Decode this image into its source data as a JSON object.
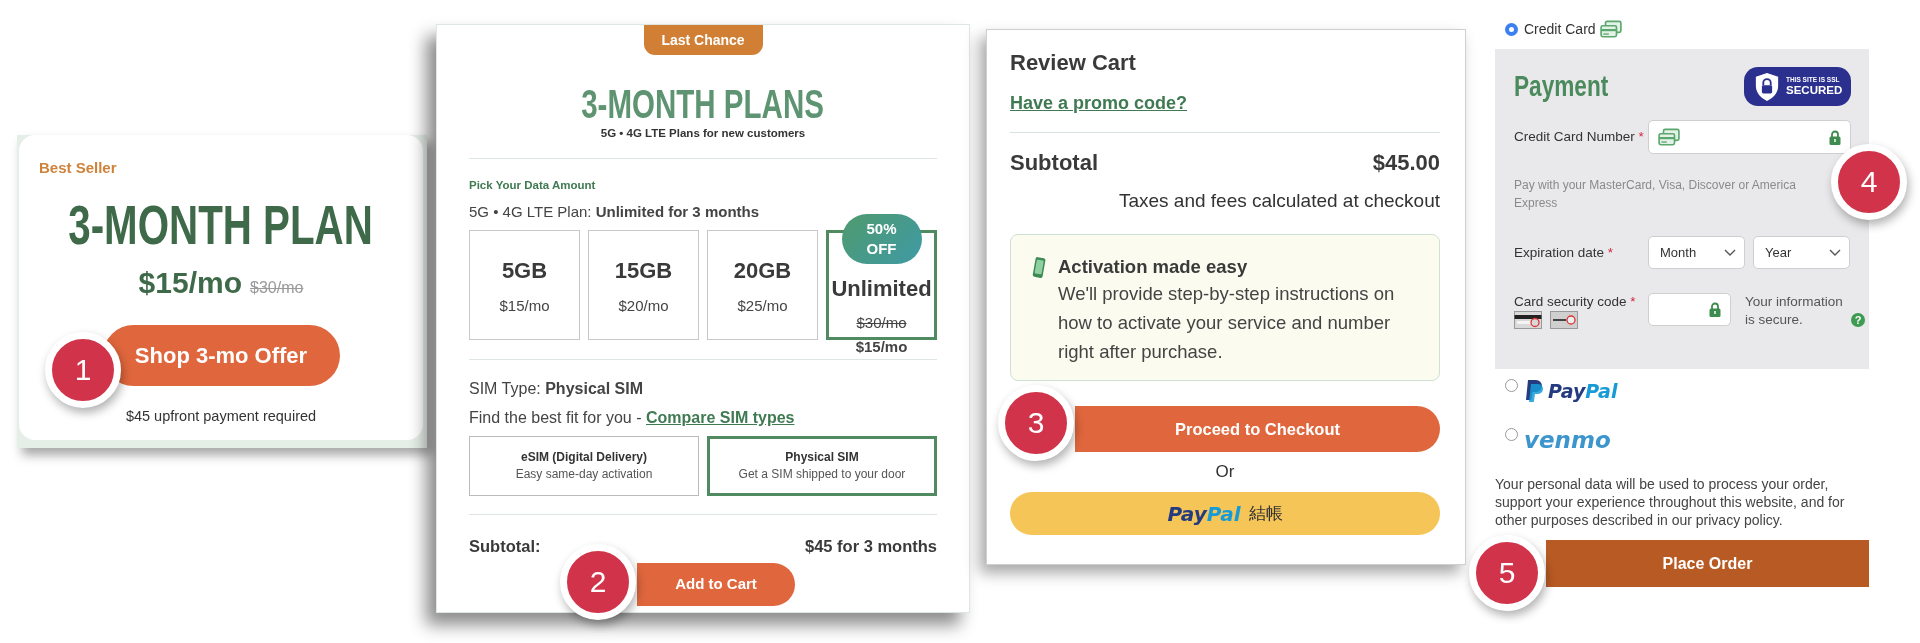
{
  "plan_card": {
    "tag": "Best Seller",
    "title": "3-MONTH PLAN",
    "price": "$15/mo",
    "old_price": "$30/mo",
    "button": "Shop 3-mo Offer",
    "note": "$45 upfront payment required",
    "step": "1"
  },
  "plans_page": {
    "ribbon": "Last Chance",
    "title": "3-MONTH PLANS",
    "subtitle": "5G • 4G LTE Plans for new customers",
    "section_label": "Pick Your Data Amount",
    "plan_line": "5G • 4G LTE Plan: **Unlimited for 3 months**",
    "data_options": [
      {
        "amount": "5GB",
        "price": "$15/mo",
        "selected": false
      },
      {
        "amount": "15GB",
        "price": "$20/mo",
        "selected": false
      },
      {
        "amount": "20GB",
        "price": "$25/mo",
        "selected": false
      },
      {
        "amount": "Unlimited",
        "discount": "50% OFF",
        "old_price": "$30/mo",
        "price": "$15/mo",
        "selected": true
      }
    ],
    "sim_line": "SIM Type: **Physical SIM**",
    "fit_text": "Find the best fit for you - ",
    "compare_link": "Compare SIM types",
    "sim_options": [
      {
        "name": "eSIM (Digital Delivery)",
        "description": "Easy same-day activation",
        "selected": false
      },
      {
        "name": "Physical SIM",
        "description": "Get a SIM shipped to your door",
        "selected": true
      }
    ],
    "subtotal_label": "Subtotal:",
    "subtotal_value": "$45 for 3 months",
    "button": "Add to Cart",
    "step": "2"
  },
  "cart": {
    "title": "Review Cart",
    "promo_link": "Have a promo code?",
    "subtotal_label": "Subtotal",
    "subtotal_value": "$45.00",
    "tax_note": "Taxes and fees calculated at checkout",
    "notice": {
      "title": "Activation made easy",
      "text": "We'll provide step-by-step instructions on how to activate your service and number right after purchase."
    },
    "checkout_button": "Proceed to Checkout",
    "or_text": "Or",
    "paypal_button": {
      "logo_parts": [
        "Pay",
        "Pal"
      ],
      "label": "結帳"
    },
    "step": "3"
  },
  "checkout": {
    "methods": [
      {
        "kind": "card",
        "label": "Credit Card",
        "selected": true
      },
      {
        "kind": "paypal",
        "label_parts": [
          "Pay",
          "Pal"
        ],
        "selected": false
      },
      {
        "kind": "venmo",
        "label": "venmo",
        "selected": false
      }
    ],
    "card_form": {
      "title": "Payment",
      "ssl_badge": [
        "THIS SITE IS SSL",
        "SECURED"
      ],
      "card_number": {
        "label": "Credit Card Number",
        "required_mark": "*"
      },
      "help_lines": [
        "Pay with your MasterCard, Visa, Discover or America",
        "Express"
      ],
      "expiration": {
        "label": "Expiration date",
        "required_mark": "*",
        "selects": [
          {
            "value": "Month"
          },
          {
            "value": "Year"
          }
        ]
      },
      "security_code": {
        "label": "Card security code",
        "required_mark": "*"
      },
      "secure_note": "Your information is secure.",
      "help_icon": "?",
      "step": "4"
    },
    "privacy_text": "Your personal data will be used to process your order, support your experience throughout this website, and for other purposes described in our privacy policy.",
    "button": "Place Order",
    "step": "5"
  }
}
